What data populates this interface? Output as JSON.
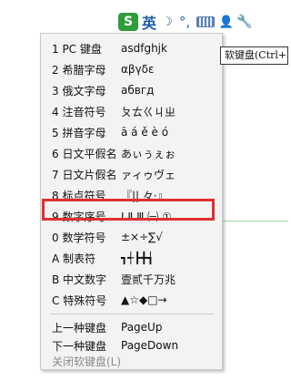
{
  "toolbar": {
    "logo": "S",
    "mode": "英",
    "moon": "☽",
    "punct": "°,",
    "user": "👤",
    "wrench": "🔧"
  },
  "tooltip": "软键盘(Ctrl+Shift+K)",
  "menu": {
    "items": [
      {
        "label": "1 PC 键盘",
        "sample": "asdfghjk"
      },
      {
        "label": "2 希腊字母",
        "sample": "αβγδε"
      },
      {
        "label": "3 俄文字母",
        "sample": "абвгд"
      },
      {
        "label": "4 注音符号",
        "sample": "ㄆㄊㄍㄐㄓ"
      },
      {
        "label": "5 拼音字母",
        "sample": "ā á ě è ó"
      },
      {
        "label": "6 日文平假名",
        "sample": "あぃぅぇぉ"
      },
      {
        "label": "7 日文片假名",
        "sample": "ァィゥヴェ"
      },
      {
        "label": "8 标点符号",
        "sample": "『|| 々·』"
      },
      {
        "label": "9 数字序号",
        "sample": "Ⅰ Ⅱ Ⅲ ㈠ ①"
      },
      {
        "label": "0 数学符号",
        "sample": "±×÷∑√"
      },
      {
        "label": "A 制表符",
        "sample": "┓┽┣╋┪"
      },
      {
        "label": "B 中文数字",
        "sample": "壹贰千万兆"
      },
      {
        "label": "C 特殊符号",
        "sample": "▲☆◆□→"
      }
    ],
    "nav": [
      {
        "label": "上一种键盘",
        "sample": "PageUp"
      },
      {
        "label": "下一种键盘",
        "sample": "PageDown"
      }
    ],
    "close": "关闭软键盘(L)"
  }
}
